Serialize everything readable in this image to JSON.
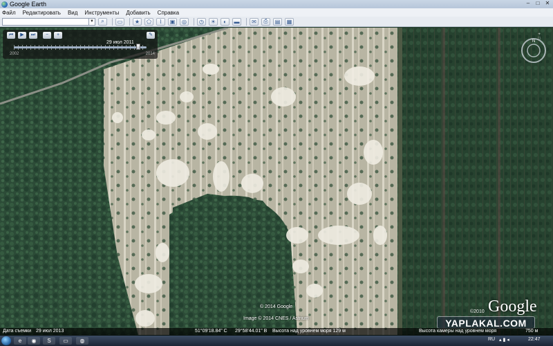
{
  "window": {
    "title": "Google Earth",
    "controls": [
      "–",
      "□",
      "✕"
    ]
  },
  "menu": [
    "Файл",
    "Редактировать",
    "Вид",
    "Инструменты",
    "Добавить",
    "Справка"
  ],
  "toolbar": {
    "search_value": ""
  },
  "time_slider": {
    "date": "29 июл 2011",
    "start_year": "2002",
    "end_year": "2014",
    "position_fraction": 0.94
  },
  "navigation": {
    "compass": "N",
    "magnifier": "+ □"
  },
  "map_credits": {
    "copyright_1": "© 2014 Google",
    "copyright_2": "Image © 2014 CNES / Astrium",
    "google_logo": "Google",
    "year_credit": "©2010"
  },
  "watermark": "YAPLAKAL.COM",
  "status": {
    "capture_date_label": "Дата съемки",
    "capture_date": "29 июл 2013",
    "latitude": "51°09'18.84\" С",
    "longitude": "29°58'44.01\" В",
    "elevation": "Высота над уровнем моря  129 м",
    "eye_altitude": "Высота камеры над уровнем моря",
    "eye_value": "750 м"
  },
  "taskbar": {
    "lang": "RU",
    "time": "22:47"
  },
  "colors": {
    "forest": "#2b4a36",
    "clearing": "#c9c4b2",
    "ui_bar": "#e7ebf1"
  }
}
